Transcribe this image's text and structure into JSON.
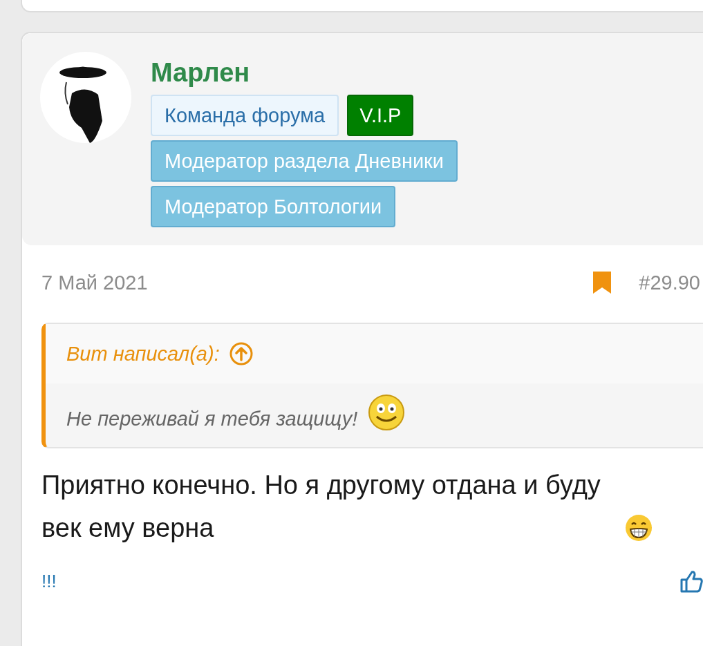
{
  "post": {
    "author": "Марлен",
    "badges": [
      {
        "label": "Команда форума",
        "kind": "light"
      },
      {
        "label": "V.I.P",
        "kind": "vip"
      },
      {
        "label": "Модератор раздела Дневники",
        "kind": "blue"
      },
      {
        "label": "Модератор Болтологии",
        "kind": "blue"
      }
    ],
    "date": "7 Май 2021",
    "bookmarked": true,
    "number": "#29.90",
    "quote": {
      "author": "Вит написал(а):",
      "text": "Не переживай я тебя защищу!"
    },
    "message": "Приятно конечно. Но я другому отдана и буду век ему верна",
    "footer_link": "!!!"
  }
}
